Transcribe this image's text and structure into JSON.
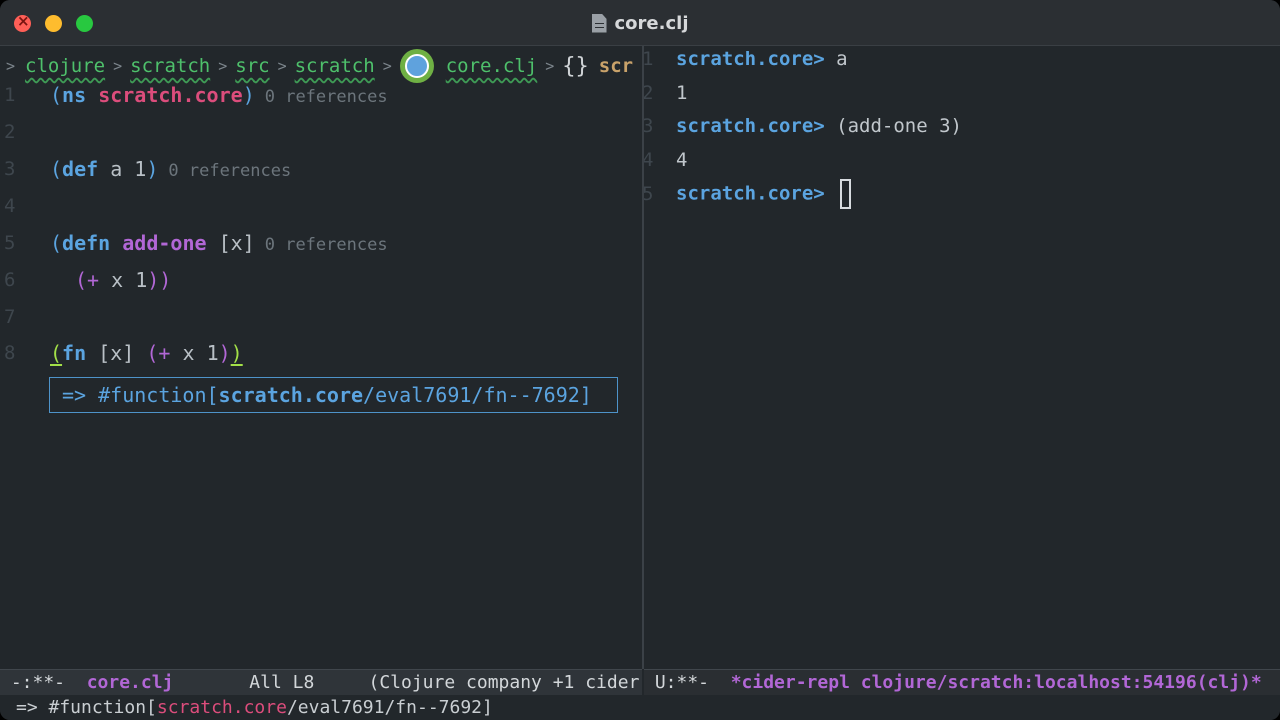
{
  "window": {
    "title": "core.clj"
  },
  "breadcrumb": {
    "items": [
      "clojure",
      "scratch",
      "src",
      "scratch",
      "core.clj"
    ],
    "symbol": "{}",
    "tail": "scr"
  },
  "editor": {
    "lines": [
      {
        "n": "1",
        "open": "(",
        "kw": "ns",
        "name": "scratch.core",
        "close": ")",
        "refs": "0 references"
      },
      {
        "n": "2"
      },
      {
        "n": "3",
        "open": "(",
        "kw": "def",
        "rest": " a 1",
        "close": ")",
        "refs": "0 references"
      },
      {
        "n": "4"
      },
      {
        "n": "5",
        "open": "(",
        "kw": "defn",
        "name": "add-one",
        "args": " [x]",
        "refs": "0 references"
      },
      {
        "n": "6",
        "open": "(",
        "op": "+",
        "rest": " x 1",
        "close": "))"
      },
      {
        "n": "7"
      },
      {
        "n": "8",
        "open": "(",
        "kw": "fn",
        "args": " [x] ",
        "inner_open": "(",
        "op": "+",
        "rest": " x 1",
        "inner_close": ")",
        "close": ")"
      }
    ],
    "result": {
      "prefix": "=> #function[",
      "ns": "scratch.core",
      "suffix": "/eval7691/fn--7692]"
    }
  },
  "repl": {
    "lines": [
      {
        "n": "1",
        "prompt": "scratch.core>",
        "input": "  a"
      },
      {
        "n": "2",
        "output": "1"
      },
      {
        "n": "3",
        "prompt": "scratch.core>",
        "input": " (add-one 3)"
      },
      {
        "n": "4",
        "output": "4"
      },
      {
        "n": "5",
        "prompt": "scratch.core>",
        "input": " "
      }
    ]
  },
  "modeline": {
    "left_state": " -:**-  ",
    "left_file": "core.clj",
    "left_pos": "       All L8     ",
    "left_modes": "(Clojure company +1 cider",
    "right_state": " U:**-  ",
    "right_buffer": "*cider-repl clojure/scratch:localhost:54196(clj)*"
  },
  "echo": {
    "prefix": "=> #function[",
    "ns": "scratch.core",
    "suffix": "/eval7691/fn--7692]"
  }
}
